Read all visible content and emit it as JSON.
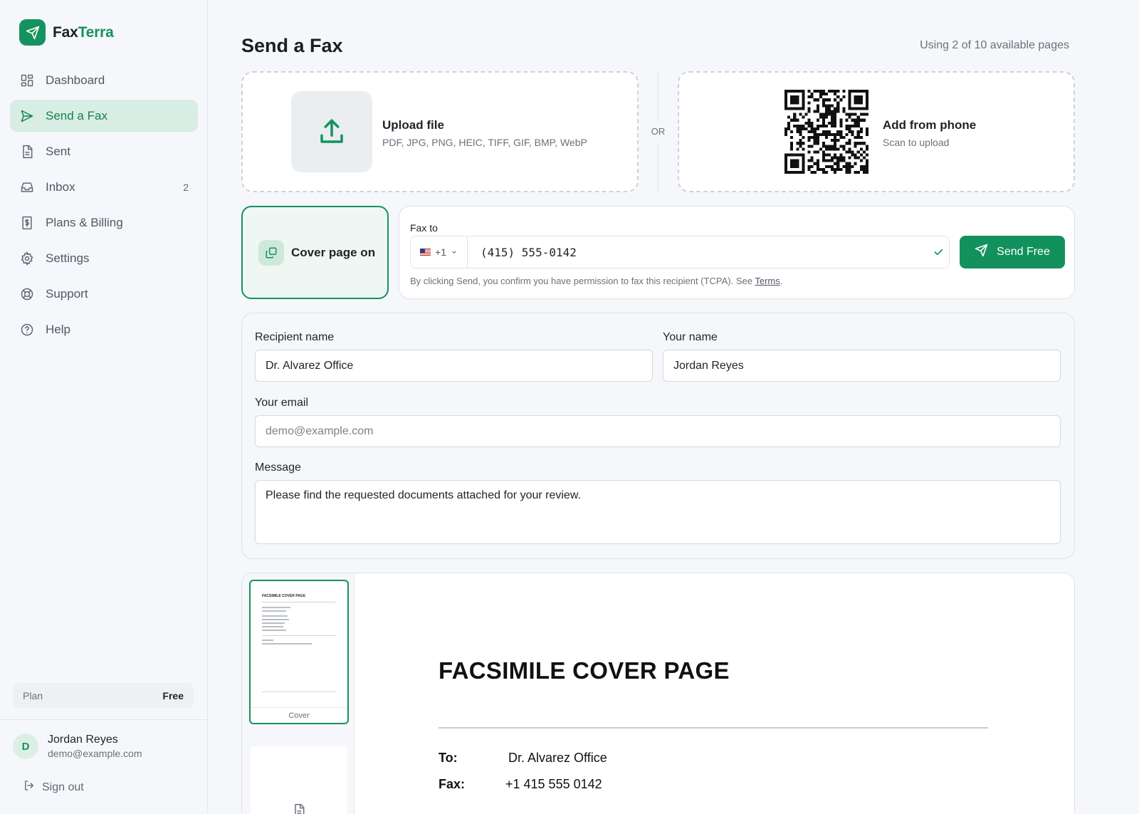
{
  "brand": {
    "name_part1": "Fax",
    "name_part2": "Terra"
  },
  "sidebar": {
    "items": [
      {
        "label": "Dashboard"
      },
      {
        "label": "Send a Fax"
      },
      {
        "label": "Sent"
      },
      {
        "label": "Inbox",
        "count": "2"
      },
      {
        "label": "Plans & Billing"
      },
      {
        "label": "Settings"
      },
      {
        "label": "Support"
      },
      {
        "label": "Help"
      }
    ],
    "plan_label": "Plan",
    "plan_value": "Free",
    "user": {
      "initial": "D",
      "name": "Jordan Reyes",
      "email": "demo@example.com"
    },
    "signout_label": "Sign out"
  },
  "main": {
    "title": "Send a Fax",
    "usage": "Using 2 of 10 available pages",
    "upload": {
      "title": "Upload file",
      "formats": "PDF, JPG, PNG, HEIC, TIFF, GIF, BMP, WebP"
    },
    "or_label": "OR",
    "phone_upload": {
      "title": "Add from phone",
      "subtitle": "Scan to upload"
    },
    "cover_toggle_label": "Cover page on",
    "fax_to": {
      "label": "Fax to",
      "country_code": "+1",
      "number": "(415) 555-0142",
      "send_label": "Send Free",
      "tcpa_text": "By clicking Send, you confirm you have permission to fax this recipient (TCPA). See ",
      "terms_link": "Terms",
      "tcpa_end": "."
    },
    "form": {
      "recipient_label": "Recipient name",
      "recipient_value": "Dr. Alvarez Office",
      "your_name_label": "Your name",
      "your_name_value": "Jordan Reyes",
      "email_label": "Your email",
      "email_placeholder": "demo@example.com",
      "message_label": "Message",
      "message_value": "Please find the requested documents attached for your review."
    },
    "preview": {
      "thumb_title": "FACSIMILE COVER PAGE",
      "thumb_caption": "Cover",
      "doc_title": "FACSIMILE COVER PAGE",
      "to_label": "To:",
      "to_value": "Dr. Alvarez Office",
      "fax_label": "Fax:",
      "fax_value": "+1 415 555 0142"
    }
  },
  "colors": {
    "accent": "#15925f",
    "accent_bg": "#d8ede3",
    "border": "#dfe3e7",
    "page_bg": "#f5f7fa"
  }
}
